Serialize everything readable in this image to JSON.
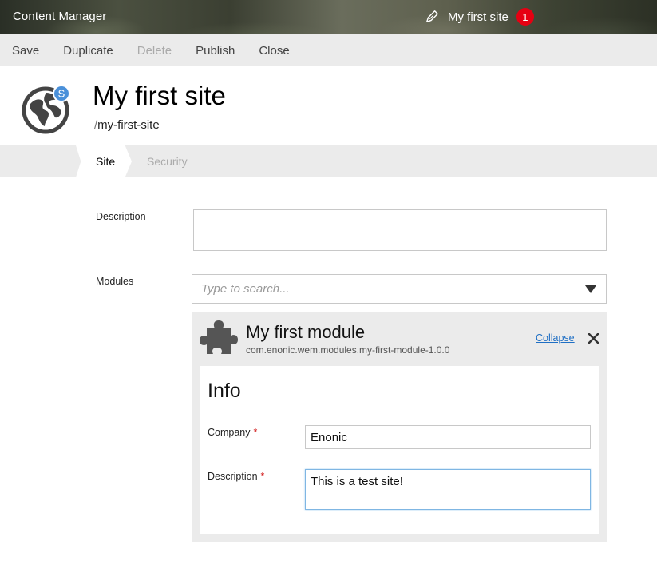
{
  "app": {
    "title": "Content Manager"
  },
  "header": {
    "site_name": "My first site",
    "notification_count": "1"
  },
  "toolbar": {
    "buttons": [
      {
        "label": "Save"
      },
      {
        "label": "Duplicate"
      },
      {
        "label": "Delete"
      },
      {
        "label": "Publish"
      },
      {
        "label": "Close"
      }
    ]
  },
  "content": {
    "title": "My first site",
    "path_prefix": "/",
    "path": "my-first-site",
    "icon_badge": "S"
  },
  "tabs": [
    {
      "label": "Site"
    },
    {
      "label": "Security"
    }
  ],
  "form": {
    "description_label": "Description",
    "description_value": "",
    "modules_label": "Modules",
    "modules_placeholder": "Type to search..."
  },
  "module": {
    "name": "My first module",
    "id": "com.enonic.wem.modules.my-first-module-1.0.0",
    "collapse_label": "Collapse",
    "info": {
      "title": "Info",
      "company_label": "Company",
      "company_value": "Enonic",
      "description_label": "Description",
      "description_value": "This is a test site!",
      "required_marker": "*"
    }
  },
  "colors": {
    "badge": "#e60012",
    "link": "#1f6fc4",
    "toolbar_bg": "#ebebeb",
    "icon_badge": "#4a90d9"
  }
}
